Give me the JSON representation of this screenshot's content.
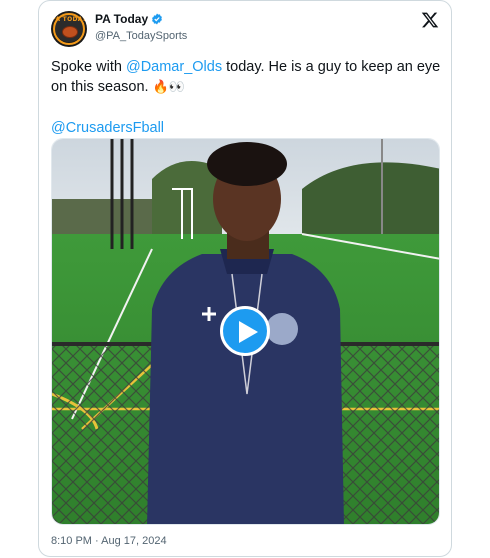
{
  "author": {
    "name": "PA Today",
    "handle": "@PA_TodaySports",
    "avatar_text": "PA TODAY"
  },
  "tweet": {
    "text_before": "Spoke with ",
    "mention1": "@Damar_Olds",
    "text_after": " today. He is a guy to keep an eye on this season. ",
    "emojis": "🔥👀",
    "mention2": "@CrusadersFball"
  },
  "media": {
    "type": "video",
    "play_icon": "play-icon"
  },
  "timestamp": "8:10 PM · Aug 17, 2024",
  "icons": {
    "brand": "x-logo-icon",
    "verified": "verified-badge-icon"
  },
  "colors": {
    "link": "#1d9bf0",
    "text": "#0f1419",
    "muted": "#536471",
    "border": "#cfd9de"
  }
}
